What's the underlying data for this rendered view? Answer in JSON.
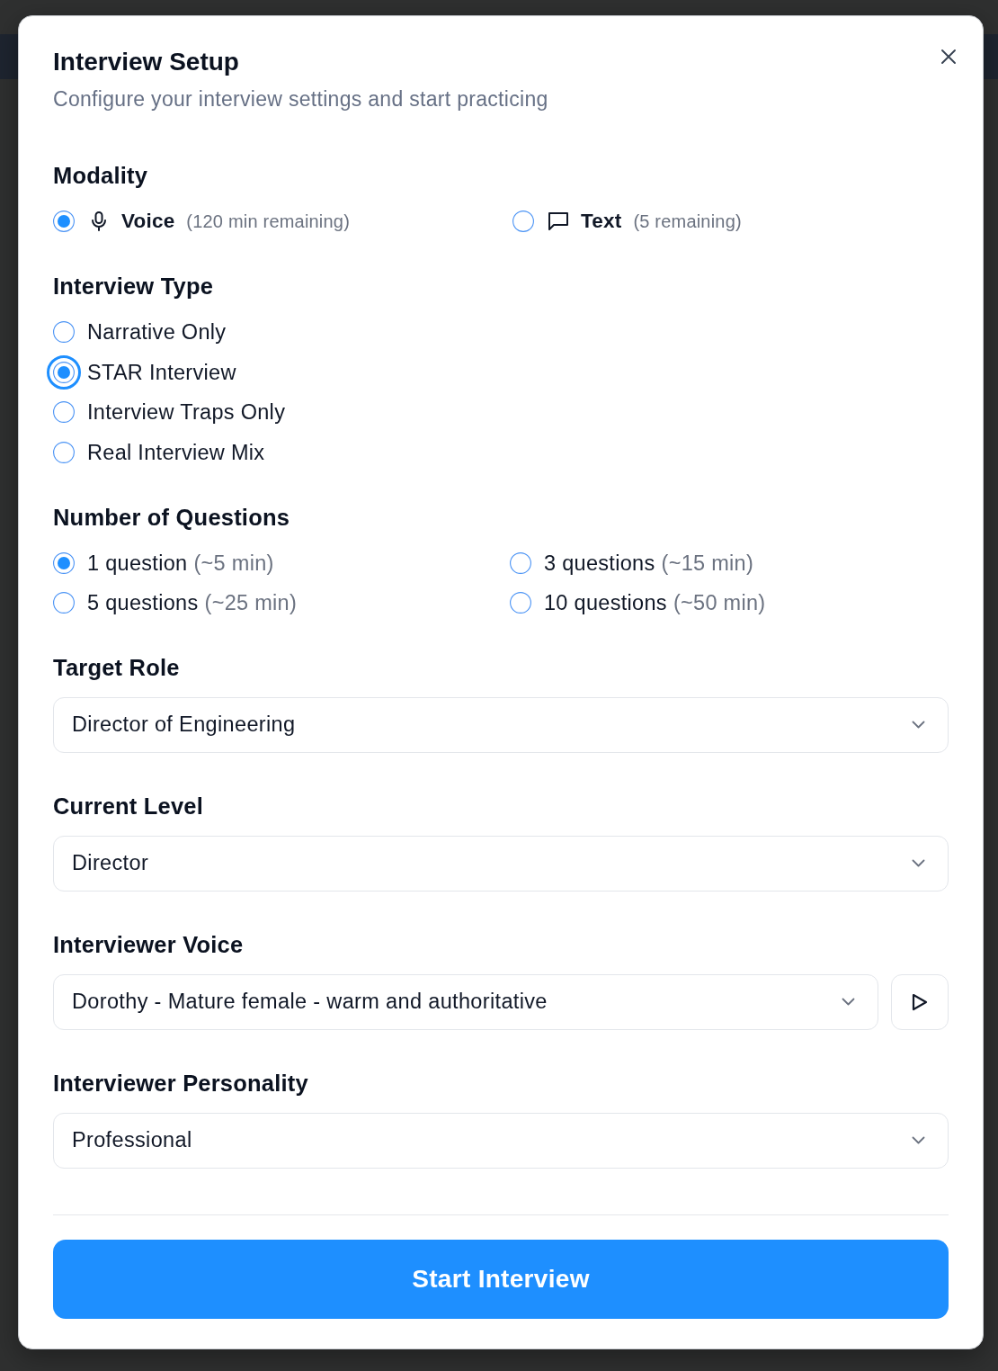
{
  "dialog": {
    "title": "Interview Setup",
    "subtitle": "Configure your interview settings and start practicing"
  },
  "modality": {
    "heading": "Modality",
    "options": [
      {
        "kind": "voice",
        "label": "Voice",
        "note": "(120 min remaining)",
        "selected": true
      },
      {
        "kind": "text",
        "label": "Text",
        "note": "(5 remaining)",
        "selected": false
      }
    ]
  },
  "interview_type": {
    "heading": "Interview Type",
    "options": [
      {
        "label": "Narrative Only",
        "selected": false,
        "focused": false
      },
      {
        "label": "STAR Interview",
        "selected": true,
        "focused": true
      },
      {
        "label": "Interview Traps Only",
        "selected": false,
        "focused": false
      },
      {
        "label": "Real Interview Mix",
        "selected": false,
        "focused": false
      }
    ]
  },
  "question_count": {
    "heading": "Number of Questions",
    "options": [
      {
        "label": "1 question",
        "note": "(~5 min)",
        "selected": true
      },
      {
        "label": "3 questions",
        "note": "(~15 min)",
        "selected": false
      },
      {
        "label": "5 questions",
        "note": "(~25 min)",
        "selected": false
      },
      {
        "label": "10 questions",
        "note": "(~50 min)",
        "selected": false
      }
    ]
  },
  "dropdowns": [
    {
      "kind": "select",
      "heading": "Target Role",
      "value": "Director of Engineering"
    },
    {
      "kind": "select",
      "heading": "Current Level",
      "value": "Director"
    },
    {
      "kind": "select_with_play",
      "heading": "Interviewer Voice",
      "value": "Dorothy - Mature female - warm and authoritative"
    },
    {
      "kind": "select",
      "heading": "Interviewer Personality",
      "value": "Professional"
    }
  ],
  "start_button": {
    "label": "Start Interview"
  }
}
